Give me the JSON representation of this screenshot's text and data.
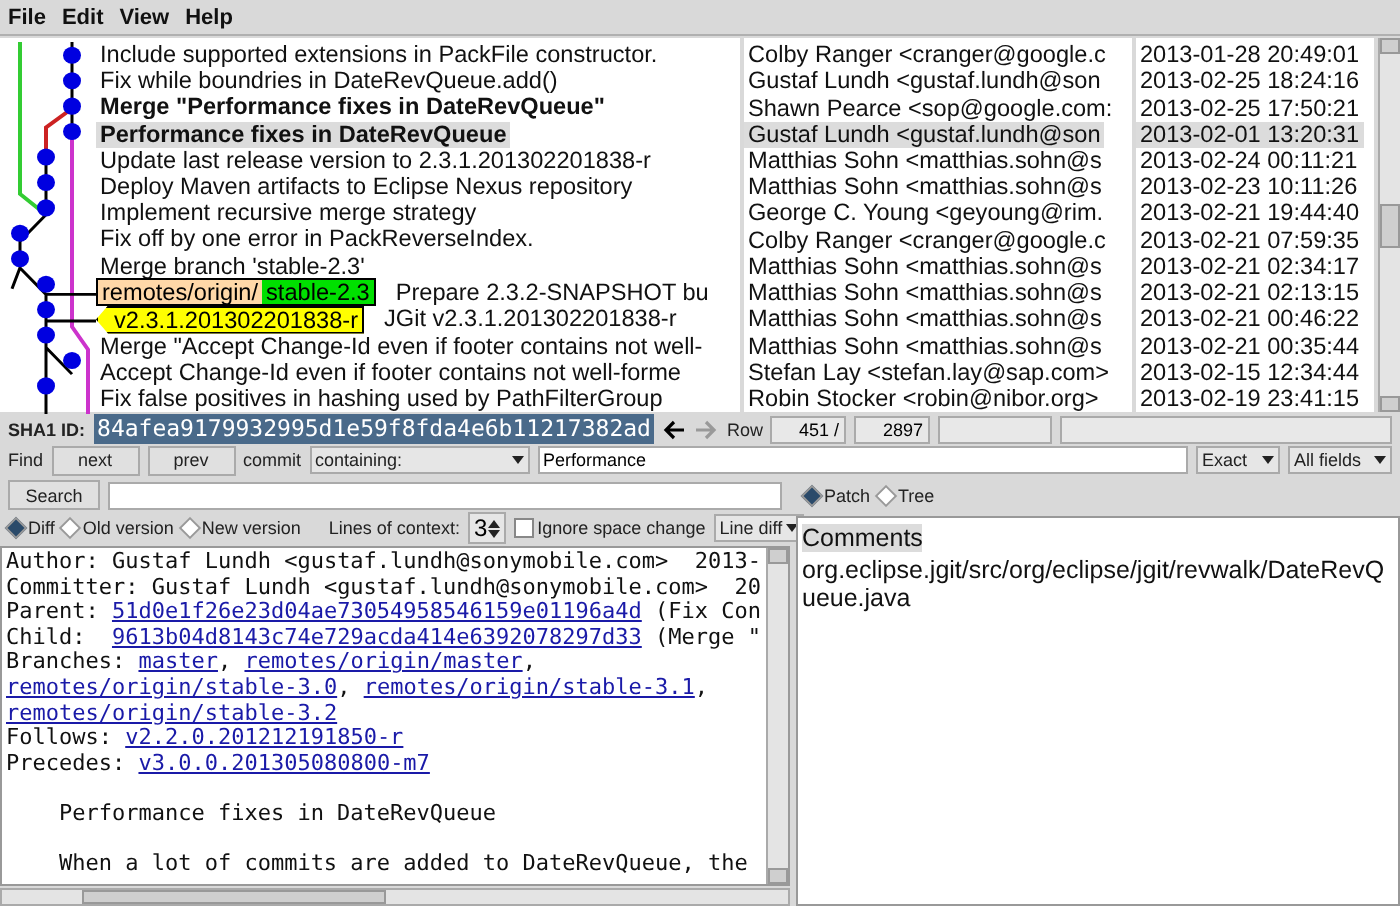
{
  "menu": [
    "File",
    "Edit",
    "View",
    "Help"
  ],
  "commits": [
    {
      "subject": "Include supported extensions in PackFile constructor.",
      "bold": false,
      "selected": false,
      "author": "Colby Ranger <cranger@google.c",
      "date": "2013-01-28 20:49:01"
    },
    {
      "subject": "Fix while boundries in DateRevQueue.add()",
      "bold": false,
      "selected": false,
      "author": "Gustaf Lundh <gustaf.lundh@son",
      "date": "2013-02-25 18:24:16"
    },
    {
      "subject": "Merge \"Performance fixes in DateRevQueue\"",
      "bold": true,
      "selected": false,
      "author": "Shawn Pearce <sop@google.com:",
      "date": "2013-02-25 17:50:21"
    },
    {
      "subject": "Performance fixes in DateRevQueue",
      "bold": true,
      "selected": true,
      "author": "Gustaf Lundh <gustaf.lundh@son",
      "date": "2013-02-01 13:20:31"
    },
    {
      "subject": "Update last release version to 2.3.1.201302201838-r",
      "bold": false,
      "selected": false,
      "author": "Matthias Sohn <matthias.sohn@s",
      "date": "2013-02-24 00:11:21"
    },
    {
      "subject": "Deploy Maven artifacts to Eclipse Nexus repository",
      "bold": false,
      "selected": false,
      "author": "Matthias Sohn <matthias.sohn@s",
      "date": "2013-02-23 10:11:26"
    },
    {
      "subject": "Implement recursive merge strategy",
      "bold": false,
      "selected": false,
      "author": "George C. Young <geyoung@rim.",
      "date": "2013-02-21 19:44:40"
    },
    {
      "subject": "Fix off by one error in PackReverseIndex.",
      "bold": false,
      "selected": false,
      "author": "Colby Ranger <cranger@google.c",
      "date": "2013-02-21 07:59:35"
    },
    {
      "subject": "Merge branch 'stable-2.3'",
      "bold": false,
      "selected": false,
      "author": "Matthias Sohn <matthias.sohn@s",
      "date": "2013-02-21 02:34:17"
    },
    {
      "subject": "Prepare 2.3.2-SNAPSHOT bu",
      "bold": false,
      "selected": false,
      "tags": [
        {
          "kind": "remote",
          "prefix": "remotes/origin/",
          "name": "stable-2.3"
        }
      ],
      "author": "Matthias Sohn <matthias.sohn@s",
      "date": "2013-02-21 02:13:15"
    },
    {
      "subject": "JGit v2.3.1.201302201838-r",
      "bold": false,
      "selected": false,
      "tags": [
        {
          "kind": "version",
          "name": "v2.3.1.201302201838-r"
        }
      ],
      "author": "Matthias Sohn <matthias.sohn@s",
      "date": "2013-02-21 00:46:22"
    },
    {
      "subject": "Merge \"Accept Change-Id even if footer contains not well-",
      "bold": false,
      "selected": false,
      "author": "Matthias Sohn <matthias.sohn@s",
      "date": "2013-02-21 00:35:44"
    },
    {
      "subject": "Accept Change-Id even if footer contains not well-forme",
      "bold": false,
      "selected": false,
      "author": "Stefan Lay <stefan.lay@sap.com>",
      "date": "2013-02-15 12:34:44"
    },
    {
      "subject": "Fix false positives in hashing used by PathFilterGroup",
      "bold": false,
      "selected": false,
      "author": "Robin Stocker <robin@nibor.org>",
      "date": "2013-02-19 23:41:15"
    }
  ],
  "sha1": {
    "label": "SHA1 ID:",
    "value": "84afea9179932995d1e59f8fda4e6b11217382ad"
  },
  "row": {
    "label": "Row",
    "current": "451 /",
    "total": "2897"
  },
  "find": {
    "label": "Find",
    "buttons": [
      "next",
      "prev"
    ],
    "type_label": "commit",
    "mode": "containing:",
    "query": "Performance",
    "match": "Exact",
    "fields": "All fields"
  },
  "search": {
    "button": "Search"
  },
  "diff_modes": [
    {
      "label": "Diff",
      "selected": true
    },
    {
      "label": "Old version",
      "selected": false
    },
    {
      "label": "New version",
      "selected": false
    }
  ],
  "context": {
    "label": "Lines of context:",
    "value": "3"
  },
  "ignore_space": {
    "label": "Ignore space change",
    "checked": false
  },
  "diff_style": "Line diff",
  "details": [
    {
      "kind": "header",
      "segments": [
        {
          "text": "Author: Gustaf Lundh <gustaf.lundh@sonymobile.com>  2013-",
          "link": false
        }
      ]
    },
    {
      "kind": "header",
      "segments": [
        {
          "text": "Committer: Gustaf Lundh <gustaf.lundh@sonymobile.com>  20",
          "link": false
        }
      ]
    },
    {
      "kind": "header",
      "segments": [
        {
          "text": "Parent: ",
          "link": false
        },
        {
          "text": "51d0e1f26e23d04ae73054958546159e01196a4d",
          "link": true
        },
        {
          "text": " (Fix Con",
          "link": false
        }
      ]
    },
    {
      "kind": "header",
      "segments": [
        {
          "text": "Child:  ",
          "link": false
        },
        {
          "text": "9613b04d8143c74e729acda414e6392078297d33",
          "link": true
        },
        {
          "text": " (Merge \"",
          "link": false
        }
      ]
    },
    {
      "kind": "header",
      "segments": [
        {
          "text": "Branches: ",
          "link": false
        },
        {
          "text": "master",
          "link": true
        },
        {
          "text": ", ",
          "link": false
        },
        {
          "text": "remotes/origin/master",
          "link": true
        },
        {
          "text": ",",
          "link": false
        }
      ]
    },
    {
      "kind": "header",
      "segments": [
        {
          "text": "remotes/origin/stable-3.0",
          "link": true
        },
        {
          "text": ", ",
          "link": false
        },
        {
          "text": "remotes/origin/stable-3.1",
          "link": true
        },
        {
          "text": ",",
          "link": false
        }
      ]
    },
    {
      "kind": "header",
      "segments": [
        {
          "text": "remotes/origin/stable-3.2",
          "link": true
        }
      ]
    },
    {
      "kind": "header",
      "segments": [
        {
          "text": "Follows: ",
          "link": false
        },
        {
          "text": "v2.2.0.201212191850-r",
          "link": true
        }
      ]
    },
    {
      "kind": "header",
      "segments": [
        {
          "text": "Precedes: ",
          "link": false
        },
        {
          "text": "v3.0.0.201305080800-m7",
          "link": true
        }
      ]
    },
    {
      "kind": "message",
      "segments": [
        {
          "text": "Performance fixes in DateRevQueue",
          "link": false
        }
      ]
    },
    {
      "kind": "message",
      "segments": [
        {
          "text": "When a lot of commits are added to DateRevQueue, the",
          "link": false
        }
      ]
    }
  ],
  "view_modes": [
    {
      "label": "Patch",
      "selected": true
    },
    {
      "label": "Tree",
      "selected": false
    }
  ],
  "files": [
    {
      "label": "Comments",
      "selected": true
    },
    {
      "label": "org.eclipse.jgit/src/org/eclipse/jgit/revwalk/DateRevQueue.java",
      "selected": false
    }
  ]
}
